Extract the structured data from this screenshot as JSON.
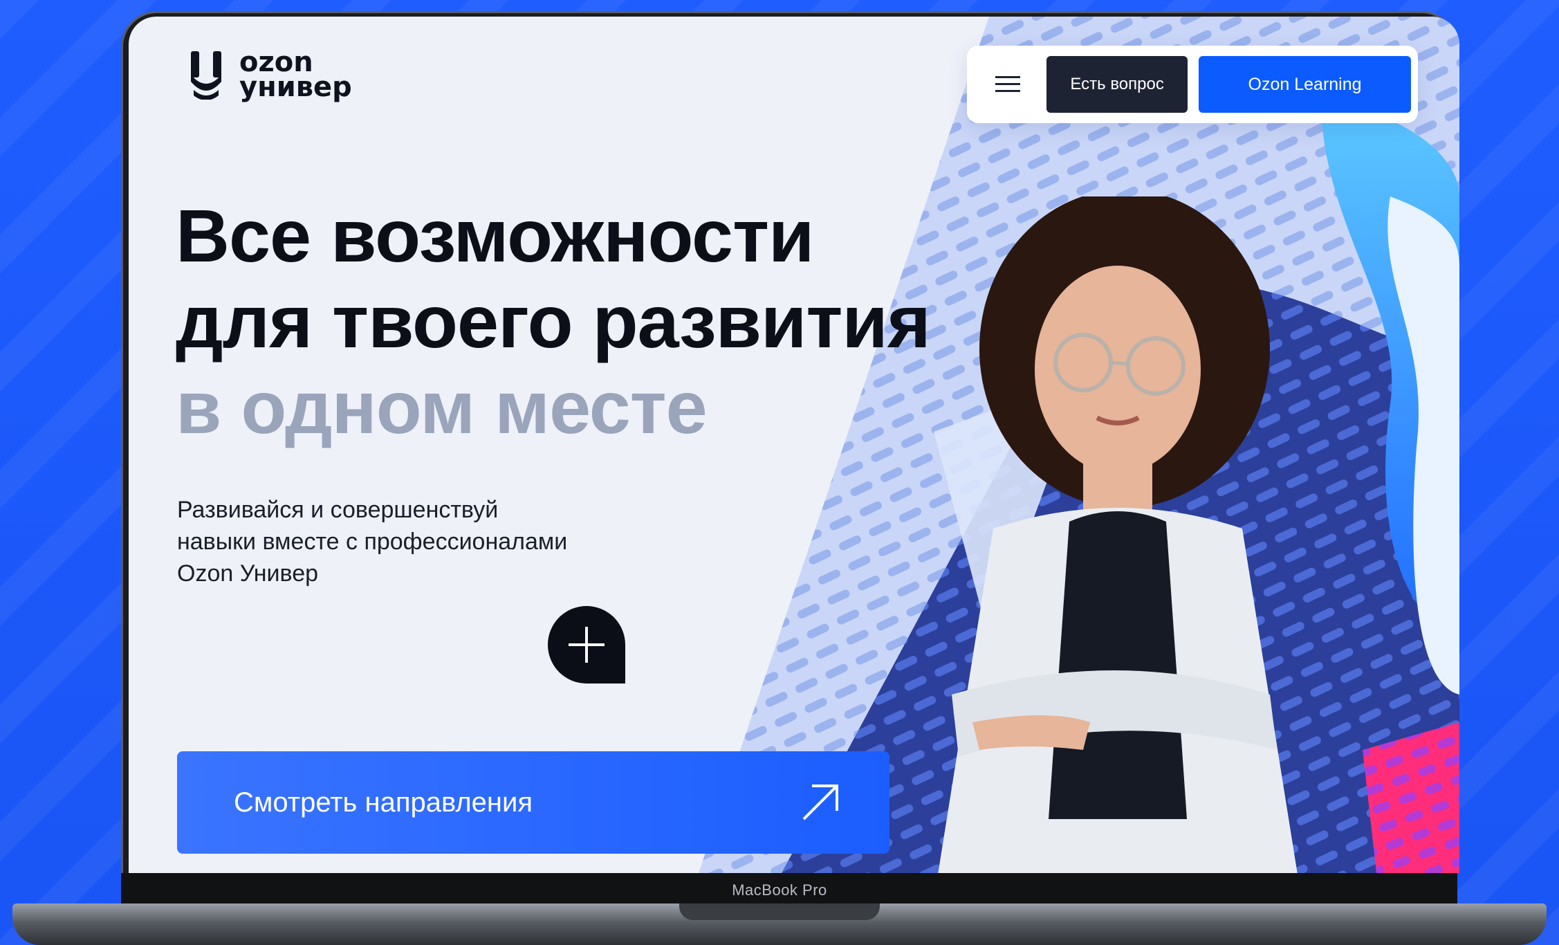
{
  "device": {
    "model_label": "MacBook Pro"
  },
  "logo": {
    "line1": "ozon",
    "line2": "универ",
    "mark_icon": "ozon-univer-logo-icon"
  },
  "nav": {
    "menu_icon": "hamburger-menu-icon",
    "ask_label": "Есть вопрос",
    "learning_label": "Ozon Learning"
  },
  "hero": {
    "headline_line1": "Все возможности",
    "headline_line2": "для твоего развития",
    "headline_line3": "в одном месте",
    "subtitle_line1": "Развивайся и совершенствуй",
    "subtitle_line2": "навыки вместе с профессионалами",
    "subtitle_line3": "Ozon Универ",
    "plus_icon": "plus-icon",
    "cta_label": "Смотреть направления",
    "cta_icon": "arrow-up-right-icon"
  },
  "colors": {
    "brand_blue": "#0b5bff",
    "dark": "#1d2333",
    "muted_text": "#9aa4bb",
    "accent_pink": "#ff2d7a"
  }
}
